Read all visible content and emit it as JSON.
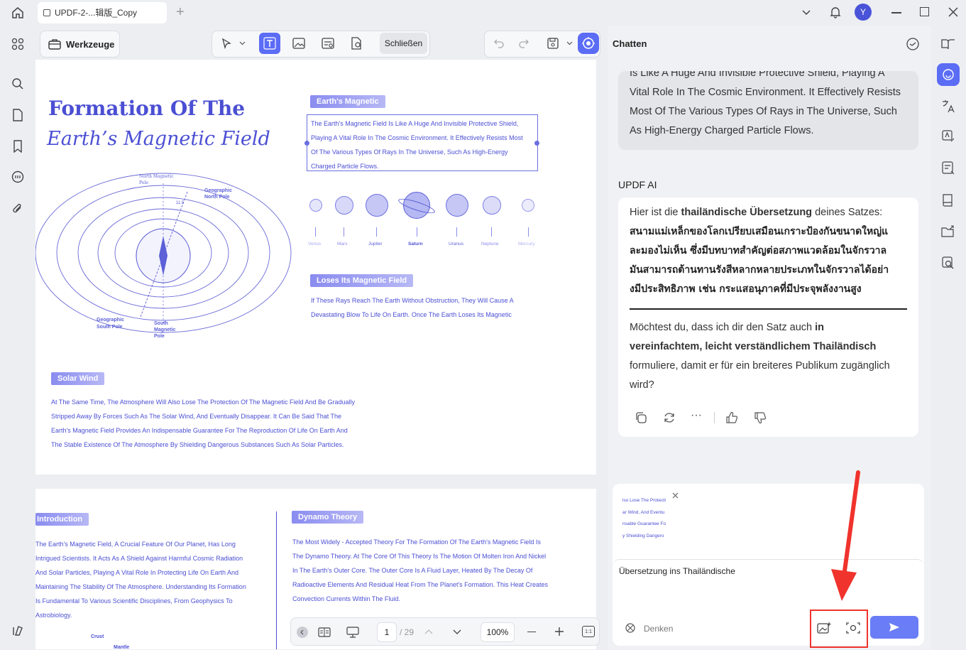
{
  "app": {
    "tab_title": "UPDF-2-...辑版_Copy",
    "avatar_letter": "Y"
  },
  "toolbar": {
    "tools_label": "Werkzeuge",
    "close_label": "Schließen"
  },
  "document": {
    "title_line1": "Formation Of The",
    "title_line2": "Earth’s Magnetic Field",
    "earth_magnetic_tag": "Earth's Magnetic",
    "earth_magnetic_lines": [
      "The Earth's Magnetic Field Is Like A Huge And Invisible Protective Shield,",
      "Playing A Vital Role In The Cosmic Environment. It Effectively Resists Most",
      "Of The Various Types Of Rays In The Universe, Such As High-Energy",
      "Charged Particle Flows."
    ],
    "planets": [
      "Venus",
      "Mars",
      "Jupiter",
      "Saturn",
      "Uranus",
      "Neptune",
      "Mercury"
    ],
    "diagram_labels": {
      "north_magnetic": "North Magnetic Pole",
      "geo_north_1": "Geographic",
      "geo_north_2": "North Pole",
      "angle": "11.5",
      "geo_south_1": "Geographic",
      "geo_south_2": "South Pole",
      "south_mag_1": "South",
      "south_mag_2": "Magnetic",
      "south_mag_3": "Pole"
    },
    "loses_tag": "Loses Its Magnetic Field",
    "loses_lines": [
      "If These Rays Reach The Earth Without Obstruction, They Will Cause A",
      "Devastating Blow To Life On Earth. Once The Earth Loses Its Magnetic"
    ],
    "solar_tag": "Solar Wind",
    "solar_lines": [
      "At The Same Time, The Atmosphere Will Also Lose The Protection Of The Magnetic Field And Be Gradually",
      "Stripped Away By Forces Such As The Solar Wind, And Eventually Disappear. It Can Be Said That The",
      "Earth's Magnetic Field Provides An Indispensable Guarantee For The Reproduction Of Life On Earth And",
      "The Stable Existence Of The Atmosphere By Shielding Dangerous Substances Such As Solar Particles."
    ],
    "intro_tag": "Introduction",
    "intro_lines": [
      "The Earth's Magnetic Field, A Crucial Feature Of Our Planet, Has Long",
      "Intrigued Scientists. It Acts As A Shield Against Harmful Cosmic Radiation",
      "And Solar Particles, Playing A Vital Role In Protecting Life On Earth And",
      "Maintaining The Stability Of The Atmosphere. Understanding Its Formation",
      "Is Fundamental To Various Scientific Disciplines, From Geophysics To",
      "Astrobiology."
    ],
    "crust_label": "Crust",
    "mantle_label": "Mantle",
    "dynamo_tag": "Dynamo Theory",
    "dynamo_lines": [
      "The Most Widely - Accepted Theory For The Formation Of The Earth's Magnetic Field Is",
      "The Dynamo Theory. At The Core Of This Theory Is The Motion Of Molten Iron And Nickel",
      "In The Earth's Outer Core. The Outer Core Is A Fluid Layer, Heated By The Decay Of",
      "Radioactive Elements And Residual Heat From The Planet's Formation. This Heat Creates",
      "Convection Currents Within The Fluid."
    ]
  },
  "pager": {
    "current_page": "1",
    "total_pages": "/ 29",
    "zoom": "100%"
  },
  "chat": {
    "header_title": "Chatten",
    "user_lines": [
      "Is Like A Huge And Invisible Protective Shield, Playing A",
      "Vital Role In The Cosmic Environment. It Effectively Resists",
      "Most Of The Various Types Of Rays in The Universe, Such",
      "As High-Energy Charged Particle Flows."
    ],
    "ai_name": "UPDF AI",
    "ai_intro_prefix": "Hier ist die ",
    "ai_intro_bold": "thailändische Übersetzung",
    "ai_intro_suffix": " deines Satzes:",
    "thai_lines": [
      "สนามแม่เหล็กของโลกเปรียบเสมือนเกราะป้องกันขนาดใหญ่แ",
      "ละมองไม่เห็น ซึ่งมีบทบาทสำคัญต่อสภาพแวดล้อมในจักรวาล",
      "มันสามารถต้านทานรังสีหลากหลายประเภทในจักรวาลได้อย่า",
      "งมีประสิทธิภาพ เช่น กระแสอนุภาคที่มีประจุพลังงานสูง"
    ],
    "followup_p1": "Möchtest du, dass ich dir den Satz auch ",
    "followup_bold1": "in",
    "followup_bold2": "vereinfachtem, leicht verständlichem Thailändisch",
    "followup_p2": "formuliere, damit er für ein breiteres Publikum zugänglich",
    "followup_p3": "wird?",
    "attachment_lines": [
      "lso Lose The Protecti",
      "ar Wind, And Eventu",
      "nsable Guarantee Fo",
      "y Shielding Dangero"
    ],
    "input_value": "Übersetzung ins Thailändische",
    "think_label": "Denken"
  },
  "colors": {
    "accent": "#5b6cf5",
    "doc_blue": "#4b4fd3",
    "annotation_red": "#f0332d"
  }
}
